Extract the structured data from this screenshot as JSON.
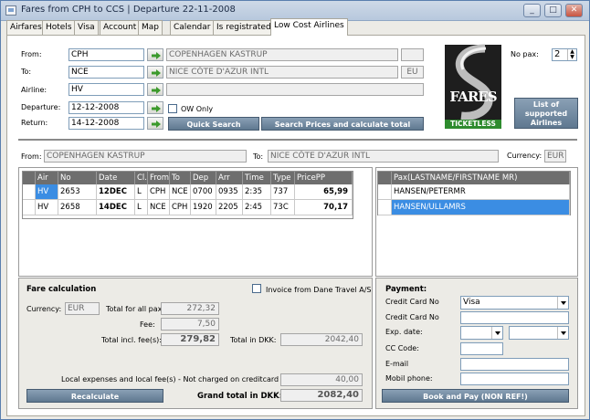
{
  "window": {
    "title": "Fares from CPH to CCS | Departure 22-11-2008"
  },
  "tabs": [
    "Airfares",
    "Hotels",
    "Visa",
    "Account",
    "Map",
    "Calendar",
    "Is registrated!",
    "Low Cost Airlines"
  ],
  "search": {
    "from_label": "From:",
    "from_code": "CPH",
    "from_name": "COPENHAGEN KASTRUP",
    "to_label": "To:",
    "to_code": "NCE",
    "to_name": "NICE CÔTE D'AZUR INTL",
    "to_country": "EU",
    "airline_label": "Airline:",
    "airline_code": "HV",
    "departure_label": "Departure:",
    "departure_date": "12-12-2008",
    "return_label": "Return:",
    "return_date": "14-12-2008",
    "ow_only_label": "OW Only",
    "quick_search_label": "Quick Search",
    "search_prices_label": "Search Prices and calculate total",
    "no_pax_label": "No pax:",
    "no_pax_value": "2"
  },
  "logo": {
    "text": "FARES",
    "ticketless": "TICKETLESS"
  },
  "supported_airlines_label": "List of supported Airlines",
  "route": {
    "from_label": "From:",
    "from_value": "COPENHAGEN KASTRUP",
    "to_label": "To:",
    "to_value": "NICE CÔTE D'AZUR INTL",
    "currency_label": "Currency:",
    "currency_value": "EUR"
  },
  "flights": {
    "columns": [
      "Air",
      "No",
      "Date",
      "Cl.",
      "From",
      "To",
      "Dep",
      "Arr",
      "Time",
      "Type",
      "PricePP"
    ],
    "rows": [
      [
        "HV",
        "2653",
        "12DEC",
        "L",
        "CPH",
        "NCE",
        "0700",
        "0935",
        "2:35",
        "737",
        "65,99"
      ],
      [
        "HV",
        "2658",
        "14DEC",
        "L",
        "NCE",
        "CPH",
        "1920",
        "2205",
        "2:45",
        "73C",
        "70,17"
      ]
    ]
  },
  "pax": {
    "header": "Pax(LASTNAME/FIRSTNAME MR)",
    "rows": [
      "HANSEN/PETERMR",
      "HANSEN/ULLAMRS"
    ]
  },
  "fare_calc": {
    "title": "Fare calculation",
    "invoice_label": "Invoice from Dane Travel A/S",
    "currency_label": "Currency:",
    "currency_value": "EUR",
    "total_all_pax_label": "Total for all pax:",
    "total_all_pax_value": "272,32",
    "fee_label": "Fee:",
    "fee_value": "7,50",
    "total_incl_fee_label": "Total incl. fee(s):",
    "total_incl_fee_value": "279,82",
    "total_dkk_label": "Total in DKK:",
    "total_dkk_value": "2042,40",
    "local_expenses_label": "Local expenses and local fee(s) - Not charged on creditcard - in DKK:",
    "local_expenses_value": "40,00",
    "recalculate_label": "Recalculate",
    "grand_total_label": "Grand total in DKK:",
    "grand_total_value": "2082,40"
  },
  "payment": {
    "title": "Payment:",
    "cc_label": "Credit Card No",
    "cc_type": "Visa",
    "cc_no_label": "Credit Card No",
    "exp_label": "Exp. date:",
    "cc_code_label": "CC Code:",
    "email_label": "E-mail",
    "mobile_label": "Mobil phone:",
    "book_label": "Book and Pay (NON REF!)"
  }
}
